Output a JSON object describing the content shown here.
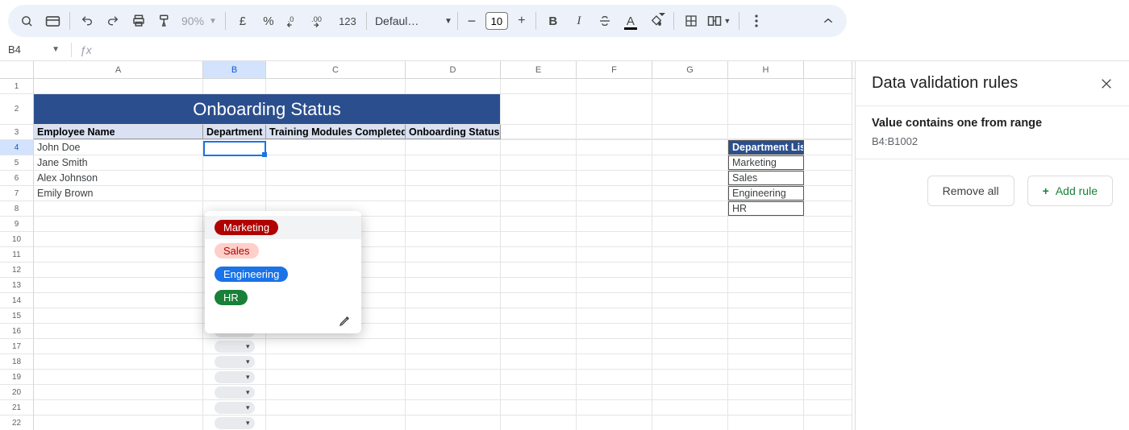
{
  "toolbar": {
    "zoom": "90%",
    "currency_symbol": "£",
    "percent_symbol": "%",
    "dec_less": ".0",
    "dec_more": ".00",
    "num_format": "123",
    "font_name": "Defaul…",
    "font_size": "10",
    "bold": "B",
    "italic": "I",
    "text_color_letter": "A"
  },
  "namebox": "B4",
  "columns": [
    "A",
    "B",
    "C",
    "D",
    "E",
    "F",
    "G",
    "H"
  ],
  "title": "Onboarding Status",
  "headers": {
    "A": "Employee Name",
    "B": "Department",
    "C": "Training Modules Completed",
    "D": "Onboarding Status"
  },
  "employees": [
    "John Doe",
    "Jane Smith",
    "Alex Johnson",
    "Emily Brown"
  ],
  "dv_options": [
    {
      "label": "Marketing",
      "cls": "red"
    },
    {
      "label": "Sales",
      "cls": "pink"
    },
    {
      "label": "Engineering",
      "cls": "blue"
    },
    {
      "label": "HR",
      "cls": "green"
    }
  ],
  "dept_list_header": "Department List",
  "dept_list": [
    "Marketing",
    "Sales",
    "Engineering",
    "HR"
  ],
  "sidepanel": {
    "title": "Data validation rules",
    "rule_title": "Value contains one from range",
    "rule_range": "B4:B1002",
    "remove": "Remove all",
    "add": "Add rule"
  }
}
